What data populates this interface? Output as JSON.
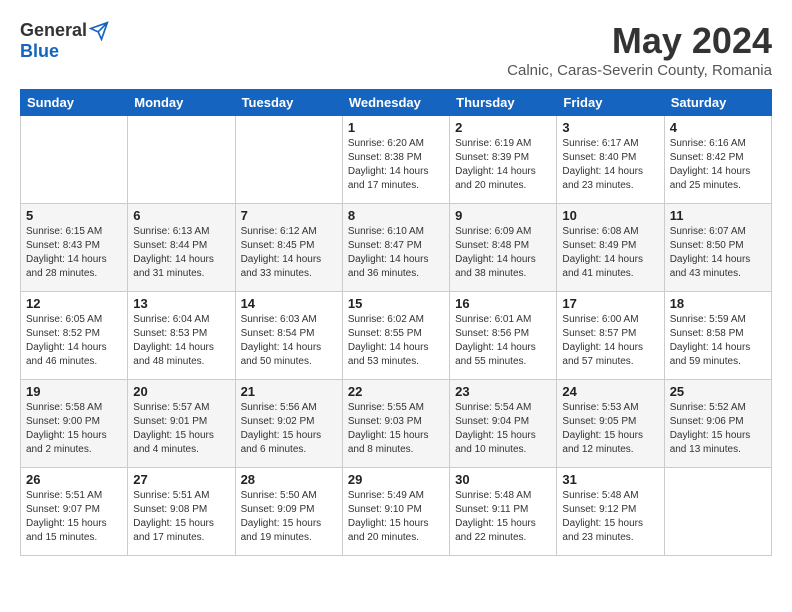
{
  "logo": {
    "general": "General",
    "blue": "Blue"
  },
  "title": "May 2024",
  "subtitle": "Calnic, Caras-Severin County, Romania",
  "headers": [
    "Sunday",
    "Monday",
    "Tuesday",
    "Wednesday",
    "Thursday",
    "Friday",
    "Saturday"
  ],
  "weeks": [
    [
      {
        "day": "",
        "info": ""
      },
      {
        "day": "",
        "info": ""
      },
      {
        "day": "",
        "info": ""
      },
      {
        "day": "1",
        "info": "Sunrise: 6:20 AM\nSunset: 8:38 PM\nDaylight: 14 hours\nand 17 minutes."
      },
      {
        "day": "2",
        "info": "Sunrise: 6:19 AM\nSunset: 8:39 PM\nDaylight: 14 hours\nand 20 minutes."
      },
      {
        "day": "3",
        "info": "Sunrise: 6:17 AM\nSunset: 8:40 PM\nDaylight: 14 hours\nand 23 minutes."
      },
      {
        "day": "4",
        "info": "Sunrise: 6:16 AM\nSunset: 8:42 PM\nDaylight: 14 hours\nand 25 minutes."
      }
    ],
    [
      {
        "day": "5",
        "info": "Sunrise: 6:15 AM\nSunset: 8:43 PM\nDaylight: 14 hours\nand 28 minutes."
      },
      {
        "day": "6",
        "info": "Sunrise: 6:13 AM\nSunset: 8:44 PM\nDaylight: 14 hours\nand 31 minutes."
      },
      {
        "day": "7",
        "info": "Sunrise: 6:12 AM\nSunset: 8:45 PM\nDaylight: 14 hours\nand 33 minutes."
      },
      {
        "day": "8",
        "info": "Sunrise: 6:10 AM\nSunset: 8:47 PM\nDaylight: 14 hours\nand 36 minutes."
      },
      {
        "day": "9",
        "info": "Sunrise: 6:09 AM\nSunset: 8:48 PM\nDaylight: 14 hours\nand 38 minutes."
      },
      {
        "day": "10",
        "info": "Sunrise: 6:08 AM\nSunset: 8:49 PM\nDaylight: 14 hours\nand 41 minutes."
      },
      {
        "day": "11",
        "info": "Sunrise: 6:07 AM\nSunset: 8:50 PM\nDaylight: 14 hours\nand 43 minutes."
      }
    ],
    [
      {
        "day": "12",
        "info": "Sunrise: 6:05 AM\nSunset: 8:52 PM\nDaylight: 14 hours\nand 46 minutes."
      },
      {
        "day": "13",
        "info": "Sunrise: 6:04 AM\nSunset: 8:53 PM\nDaylight: 14 hours\nand 48 minutes."
      },
      {
        "day": "14",
        "info": "Sunrise: 6:03 AM\nSunset: 8:54 PM\nDaylight: 14 hours\nand 50 minutes."
      },
      {
        "day": "15",
        "info": "Sunrise: 6:02 AM\nSunset: 8:55 PM\nDaylight: 14 hours\nand 53 minutes."
      },
      {
        "day": "16",
        "info": "Sunrise: 6:01 AM\nSunset: 8:56 PM\nDaylight: 14 hours\nand 55 minutes."
      },
      {
        "day": "17",
        "info": "Sunrise: 6:00 AM\nSunset: 8:57 PM\nDaylight: 14 hours\nand 57 minutes."
      },
      {
        "day": "18",
        "info": "Sunrise: 5:59 AM\nSunset: 8:58 PM\nDaylight: 14 hours\nand 59 minutes."
      }
    ],
    [
      {
        "day": "19",
        "info": "Sunrise: 5:58 AM\nSunset: 9:00 PM\nDaylight: 15 hours\nand 2 minutes."
      },
      {
        "day": "20",
        "info": "Sunrise: 5:57 AM\nSunset: 9:01 PM\nDaylight: 15 hours\nand 4 minutes."
      },
      {
        "day": "21",
        "info": "Sunrise: 5:56 AM\nSunset: 9:02 PM\nDaylight: 15 hours\nand 6 minutes."
      },
      {
        "day": "22",
        "info": "Sunrise: 5:55 AM\nSunset: 9:03 PM\nDaylight: 15 hours\nand 8 minutes."
      },
      {
        "day": "23",
        "info": "Sunrise: 5:54 AM\nSunset: 9:04 PM\nDaylight: 15 hours\nand 10 minutes."
      },
      {
        "day": "24",
        "info": "Sunrise: 5:53 AM\nSunset: 9:05 PM\nDaylight: 15 hours\nand 12 minutes."
      },
      {
        "day": "25",
        "info": "Sunrise: 5:52 AM\nSunset: 9:06 PM\nDaylight: 15 hours\nand 13 minutes."
      }
    ],
    [
      {
        "day": "26",
        "info": "Sunrise: 5:51 AM\nSunset: 9:07 PM\nDaylight: 15 hours\nand 15 minutes."
      },
      {
        "day": "27",
        "info": "Sunrise: 5:51 AM\nSunset: 9:08 PM\nDaylight: 15 hours\nand 17 minutes."
      },
      {
        "day": "28",
        "info": "Sunrise: 5:50 AM\nSunset: 9:09 PM\nDaylight: 15 hours\nand 19 minutes."
      },
      {
        "day": "29",
        "info": "Sunrise: 5:49 AM\nSunset: 9:10 PM\nDaylight: 15 hours\nand 20 minutes."
      },
      {
        "day": "30",
        "info": "Sunrise: 5:48 AM\nSunset: 9:11 PM\nDaylight: 15 hours\nand 22 minutes."
      },
      {
        "day": "31",
        "info": "Sunrise: 5:48 AM\nSunset: 9:12 PM\nDaylight: 15 hours\nand 23 minutes."
      },
      {
        "day": "",
        "info": ""
      }
    ]
  ]
}
